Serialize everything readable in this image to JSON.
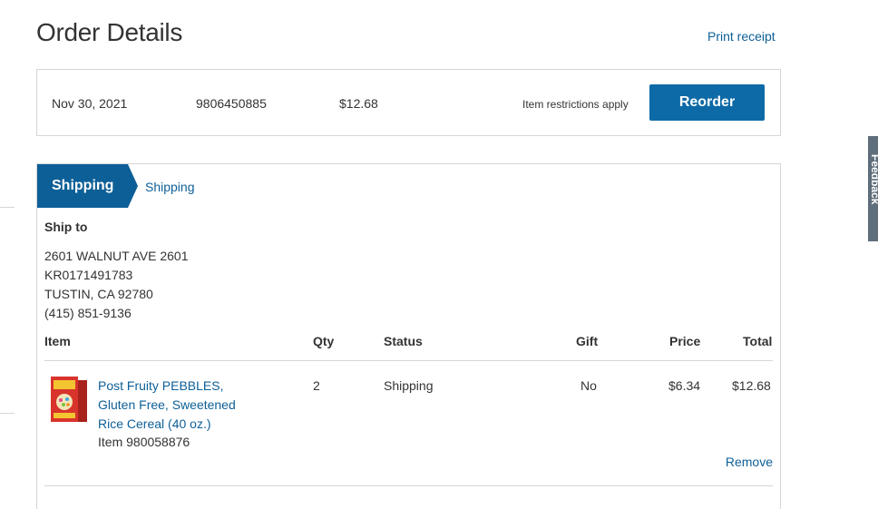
{
  "page": {
    "title": "Order Details",
    "print_receipt": "Print receipt"
  },
  "summary": {
    "date": "Nov 30, 2021",
    "order_number": "9806450885",
    "total": "$12.68",
    "restrictions": "Item restrictions apply",
    "reorder_label": "Reorder"
  },
  "shipping": {
    "tab_label": "Shipping",
    "status": "Shipping",
    "ship_to_label": "Ship to",
    "address": [
      "2601 WALNUT AVE 2601",
      "KR0171491783",
      "TUSTIN, CA 92780",
      "(415) 851-9136"
    ]
  },
  "table": {
    "headers": [
      "Item",
      "Qty",
      "Status",
      "Gift",
      "Price",
      "Total"
    ],
    "rows": [
      {
        "name": "Post Fruity PEBBLES, Gluten Free, Sweetened Rice Cereal (40 oz.)",
        "item_number": "Item 980058876",
        "qty": "2",
        "status": "Shipping",
        "gift": "No",
        "price": "$6.34",
        "total": "$12.68",
        "remove": "Remove",
        "image_icon": "cereal-box-icon"
      }
    ]
  },
  "feedback": {
    "label": "Feedback"
  },
  "colors": {
    "brand_blue": "#0d6aa7",
    "link_blue": "#0d5f97",
    "border": "#d6d6d6",
    "text": "#333333"
  }
}
